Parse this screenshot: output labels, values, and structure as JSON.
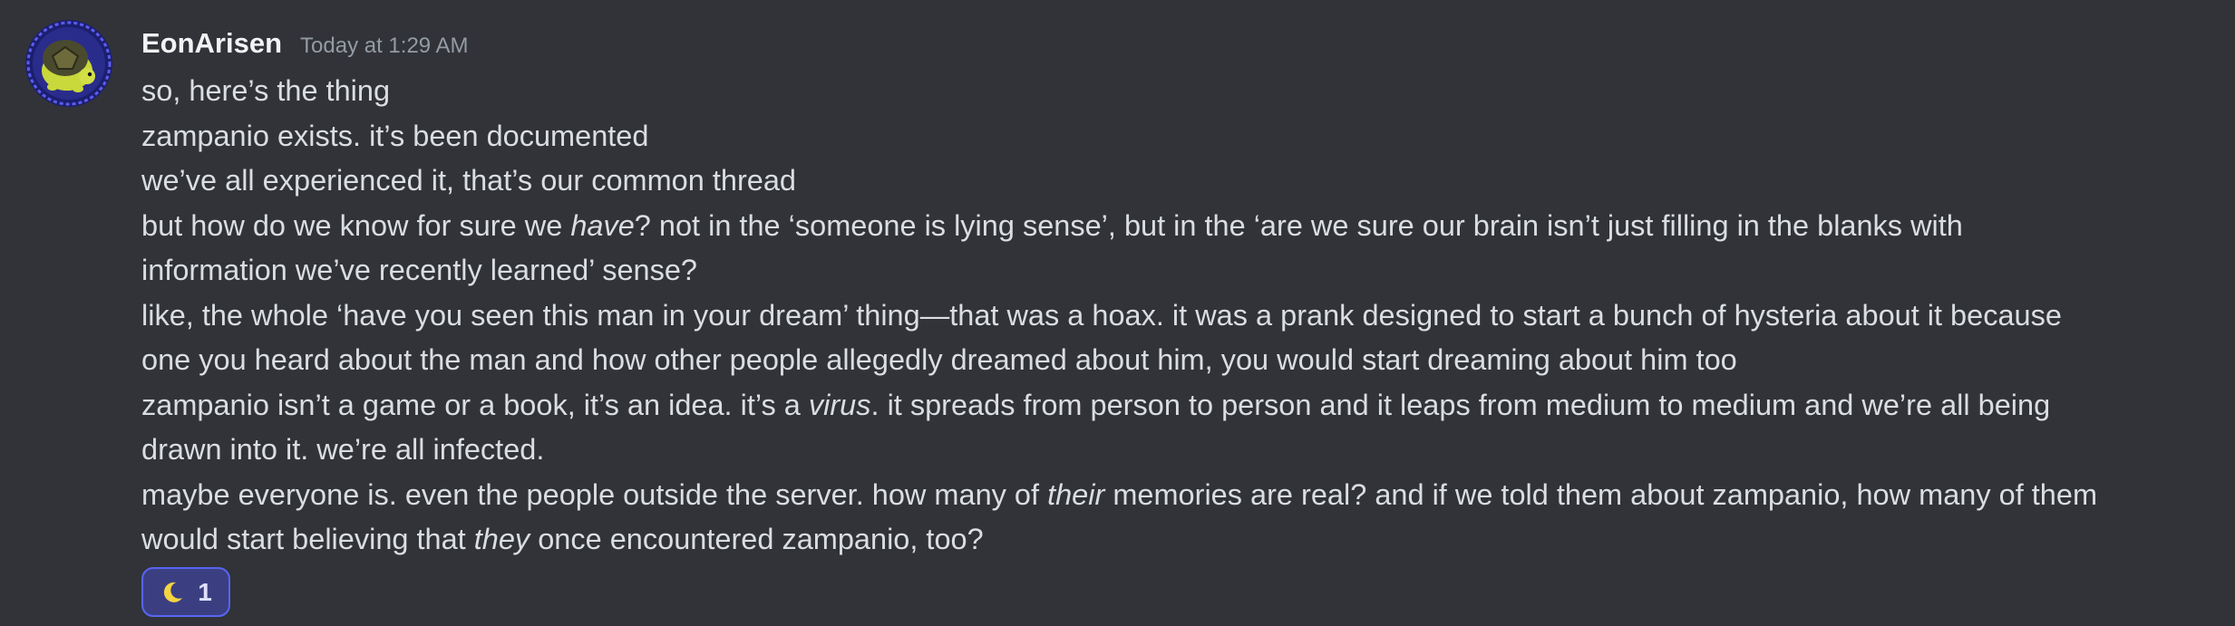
{
  "message": {
    "author": "EonArisen",
    "timestamp": "Today at 1:29 AM",
    "avatar_icon": "turtle-avatar",
    "lines": [
      [
        "so, here’s the thing"
      ],
      [
        "zampanio exists. it’s been documented"
      ],
      [
        "we’ve all experienced it, that’s our common thread"
      ],
      [
        "but how do we know for sure we ",
        "have",
        "? not in the ‘someone is lying sense’, but in the ‘are we sure our brain isn’t just filling in the blanks with"
      ],
      [
        "information we’ve recently learned’ sense?"
      ],
      [
        "like, the whole ‘have you seen this man in your dream’ thing—that was a hoax. it was a prank designed to start a bunch of hysteria about it because"
      ],
      [
        "one you heard about the man and how other people allegedly dreamed about him, you would start dreaming about him too"
      ],
      [
        "zampanio isn’t a game or a book, it’s an idea. it’s a ",
        "virus",
        ". it spreads from person to person and it leaps from medium to medium and we’re all being"
      ],
      [
        "drawn into it. we’re all infected."
      ],
      [
        "maybe everyone is. even the people outside the server. how many of ",
        "their",
        " memories are real? and if we told them about zampanio, how many of them"
      ],
      [
        "would start believing that ",
        "they",
        " once encountered zampanio, too?"
      ]
    ]
  },
  "reaction": {
    "emoji_icon": "crescent-moon-icon",
    "count": "1"
  },
  "colors": {
    "background": "#313338",
    "text": "#dbdee1",
    "username": "#f2f3f5",
    "timestamp": "#949ba4",
    "reaction_border": "#5865f2",
    "reaction_bg": "#3b3f82",
    "moon": "#f5d442"
  }
}
